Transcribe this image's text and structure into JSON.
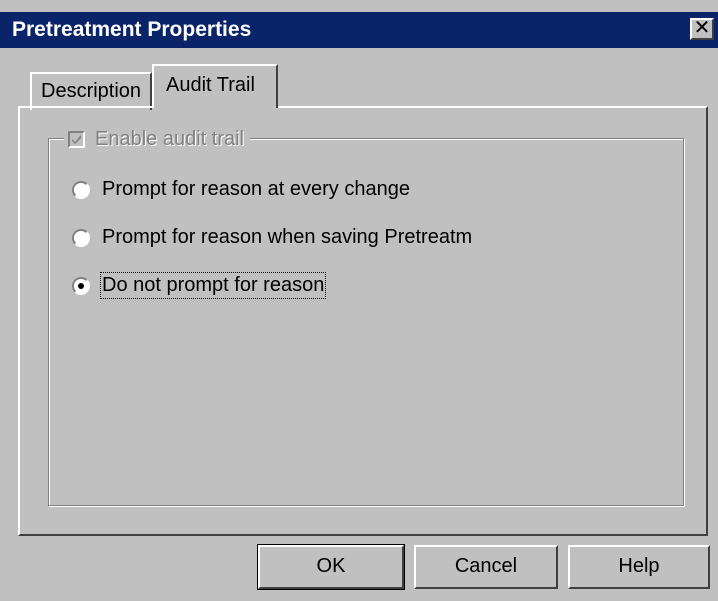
{
  "window": {
    "title": "Pretreatment Properties",
    "close_glyph": "✕",
    "colors": {
      "titlebar": "#0a246a",
      "face": "#c0c0c0"
    }
  },
  "tabs": [
    {
      "label": "Description",
      "selected": false
    },
    {
      "label": "Audit Trail",
      "selected": true
    }
  ],
  "audit_trail": {
    "enable_label": "Enable audit trail",
    "enable_checked": true,
    "enable_disabled": true,
    "options": [
      {
        "label": "Prompt for reason at every change",
        "selected": false
      },
      {
        "label": "Prompt for reason when saving Pretreatm",
        "selected": false
      },
      {
        "label": "Do not prompt for reason",
        "selected": true
      }
    ]
  },
  "buttons": {
    "ok": "OK",
    "cancel": "Cancel",
    "help": "Help"
  }
}
